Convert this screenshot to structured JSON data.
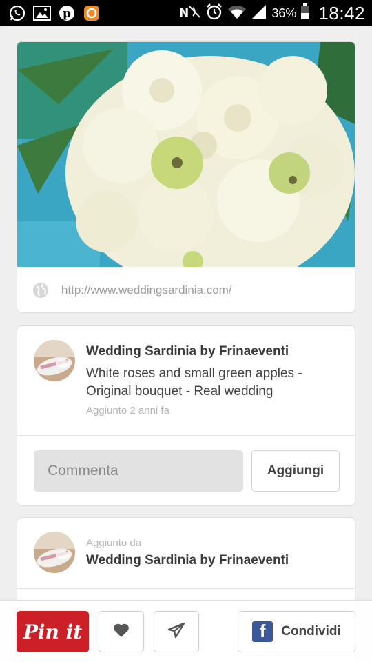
{
  "status_bar": {
    "left_icons": [
      "whatsapp-icon",
      "gallery-icon",
      "pinterest-icon",
      "orange-app-icon"
    ],
    "right_icons": [
      "nfc-icon",
      "alarm-icon",
      "wifi-icon",
      "signal-icon",
      "battery-icon"
    ],
    "battery": "36%",
    "time": "18:42"
  },
  "pin": {
    "image_alt": "White roses bouquet with small green apples",
    "source_url": "http://www.weddingsardinia.com/",
    "pinner": "Wedding Sardinia by Frinaeventi",
    "description": "White roses and small green apples - Original bouquet - Real wedding",
    "added_ago": "Aggiunto 2 anni fa"
  },
  "comment": {
    "placeholder": "Commenta",
    "add_label": "Aggiungi"
  },
  "added_by": {
    "label": "Aggiunto da",
    "name": "Wedding Sardinia by Frinaeventi"
  },
  "action_bar": {
    "pinit_label": "Pin it",
    "like_icon": "heart-icon",
    "send_icon": "send-icon",
    "share_label": "Condividi",
    "share_icon": "facebook-icon"
  },
  "colors": {
    "pinit_red": "#cb2027",
    "facebook_blue": "#3b5998"
  }
}
